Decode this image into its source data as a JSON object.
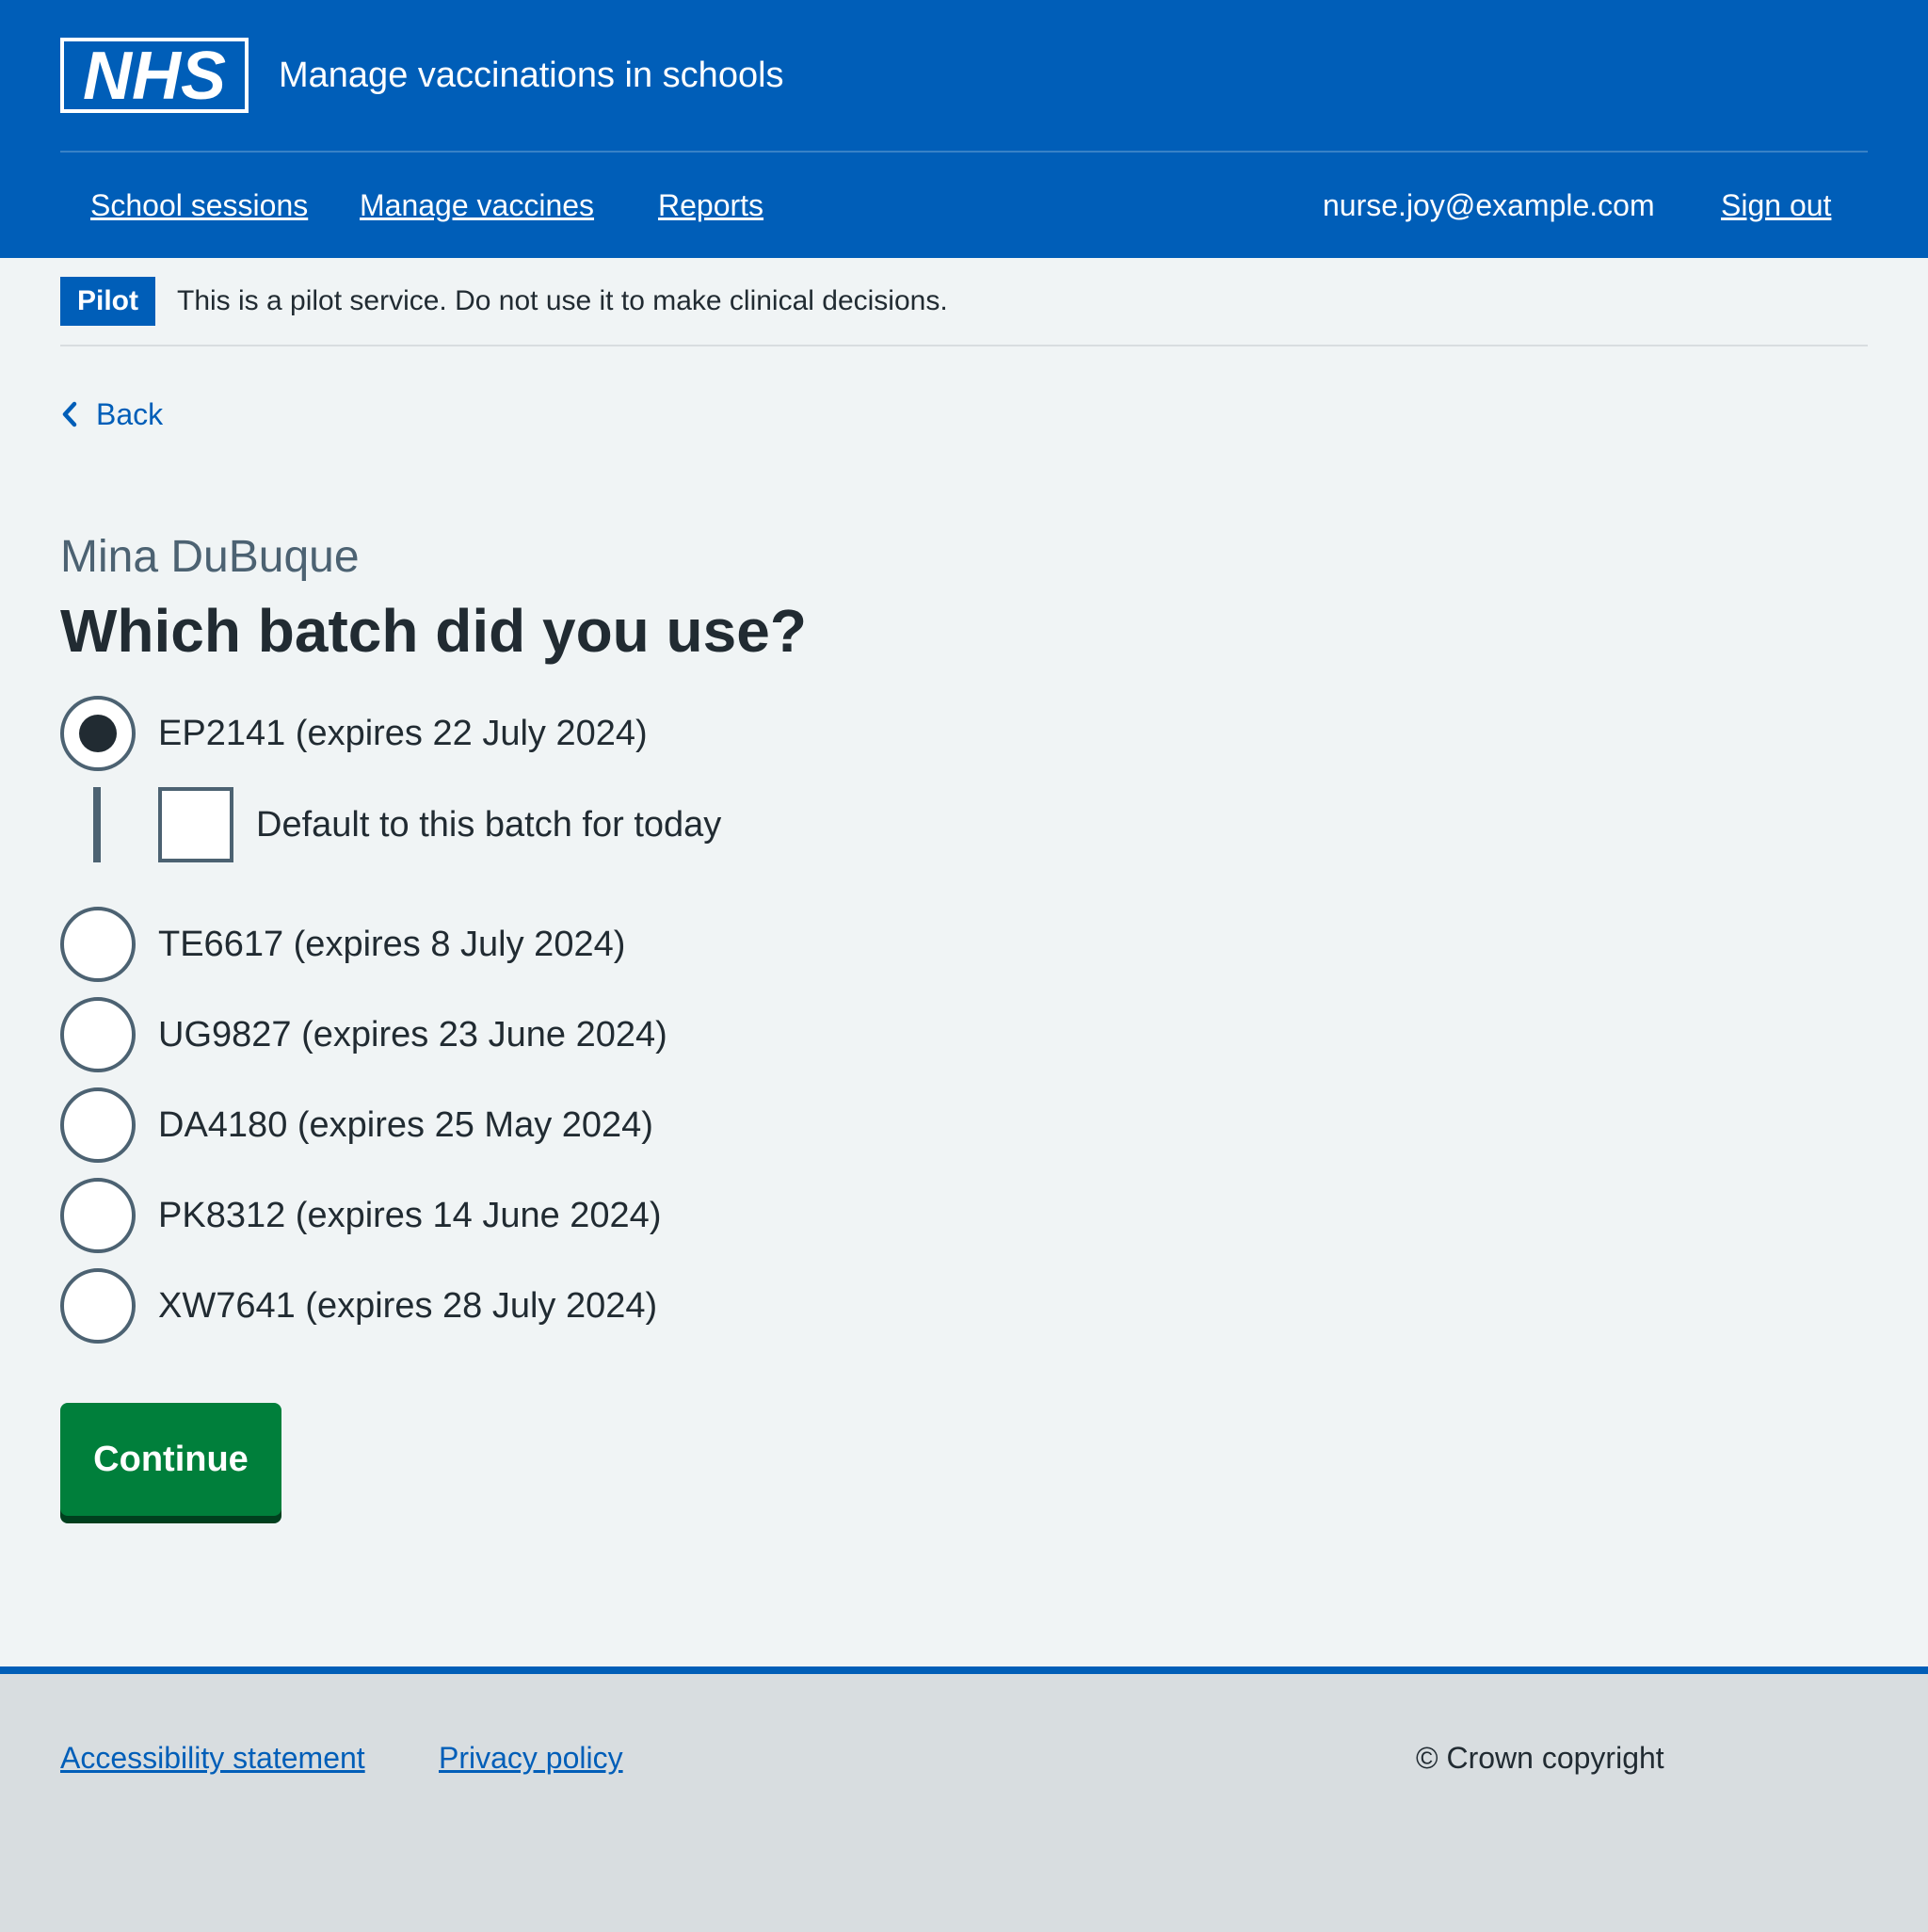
{
  "header": {
    "logo_text": "NHS",
    "service_name": "Manage vaccinations in schools",
    "nav": [
      {
        "label": "School sessions"
      },
      {
        "label": "Manage vaccines"
      },
      {
        "label": "Reports"
      }
    ],
    "user_email": "nurse.joy@example.com",
    "sign_out_label": "Sign out"
  },
  "banner": {
    "tag": "Pilot",
    "message": "This is a pilot service. Do not use it to make clinical decisions."
  },
  "back_label": "Back",
  "page": {
    "caption": "Mina DuBuque",
    "title": "Which batch did you use?",
    "options": [
      {
        "label": "EP2141 (expires 22 July 2024)",
        "checked": true
      },
      {
        "label": "TE6617 (expires 8 July 2024)",
        "checked": false
      },
      {
        "label": "UG9827 (expires 23 June 2024)",
        "checked": false
      },
      {
        "label": "DA4180 (expires 25 May 2024)",
        "checked": false
      },
      {
        "label": "PK8312 (expires 14 June 2024)",
        "checked": false
      },
      {
        "label": "XW7641 (expires 28 July 2024)",
        "checked": false
      }
    ],
    "default_checkbox": {
      "label": "Default to this batch for today",
      "checked": false
    },
    "continue_label": "Continue"
  },
  "footer": {
    "links": [
      {
        "label": "Accessibility statement"
      },
      {
        "label": "Privacy policy"
      }
    ],
    "copyright": "© Crown copyright"
  },
  "colors": {
    "nhs_blue": "#005eb8",
    "button_green": "#007f3b",
    "background": "#f0f4f5",
    "footer_background": "#d8dde0",
    "text": "#212b32",
    "secondary_text": "#4c6272"
  }
}
